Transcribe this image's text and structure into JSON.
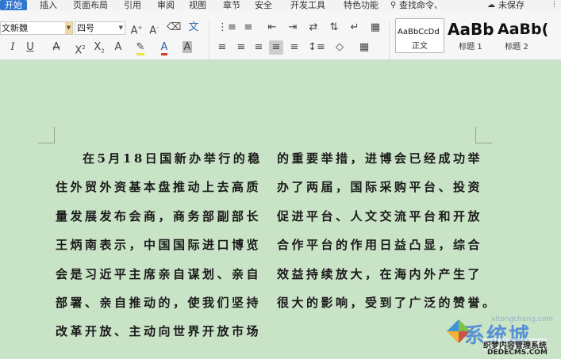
{
  "menu": {
    "tabs": [
      "开始",
      "插入",
      "页面布局",
      "引用",
      "审阅",
      "视图",
      "章节",
      "安全",
      "开发工具",
      "特色功能"
    ],
    "search": "查找命令、",
    "unsaved": "未保存"
  },
  "ribbon": {
    "font_name": "文新魏",
    "font_size": "四号",
    "styles": [
      {
        "sample": "AaBbCcDd",
        "label": "正文"
      },
      {
        "sample": "AaBb",
        "label": "标题 1"
      },
      {
        "sample": "AaBb(",
        "label": "标题 2"
      }
    ]
  },
  "document": {
    "left_column": [
      "在5月18日国新办举行的稳",
      "住外贸外资基本盘推动上去高质",
      "量发展发布会商，商务部副部长",
      "王炳南表示，中国国际进口博览",
      "会是习近平主席亲自谋划、亲自",
      "部署、亲自推动的，使我们坚持",
      "改革开放、主动向世界开放市场"
    ],
    "right_column": [
      "的重要举措，进博会已经成功举",
      "办了两届，国际采购平台、投资",
      "促进平台、人文交流平台和开放",
      "合作平台的作用日益凸显，综合",
      "效益持续放大，在海内外产生了",
      "很大的影响，受到了广泛的赞誉。"
    ]
  },
  "watermark": {
    "brand": "系统城",
    "url": "xitongcheng.com",
    "site_cn": "织梦内容管理系统",
    "site_en": "DEDECMS.COM"
  }
}
